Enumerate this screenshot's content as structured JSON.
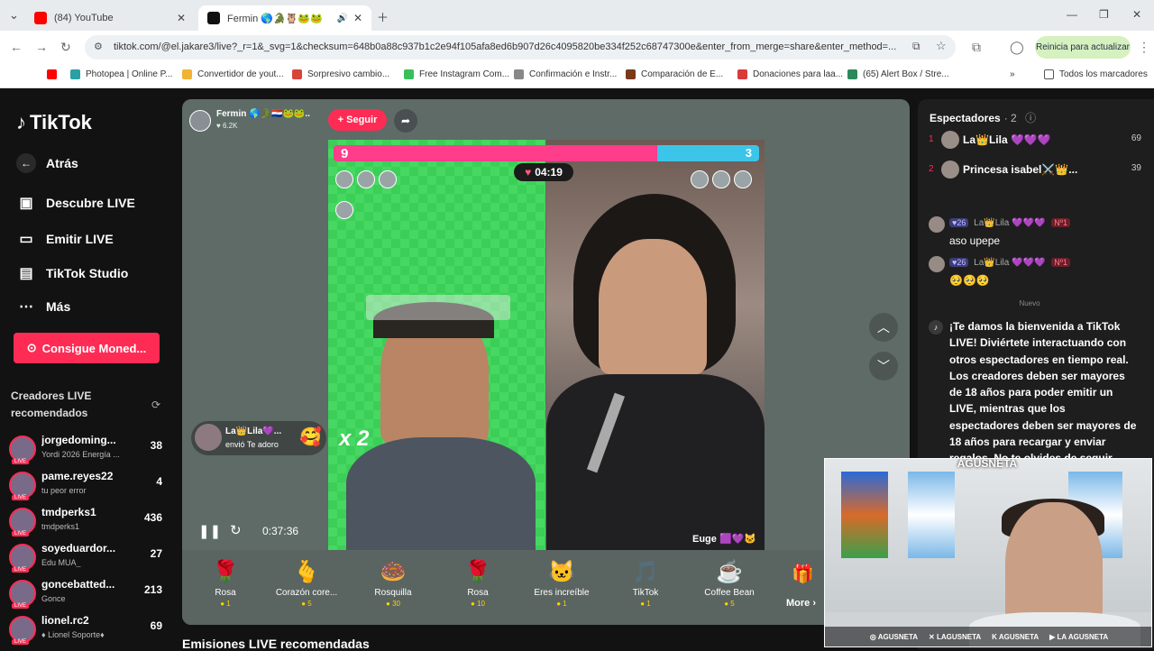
{
  "browser": {
    "tabs": [
      {
        "title": "(84) YouTube",
        "active": false,
        "favicon_color": "#ff0000"
      },
      {
        "title": "Fermin 🌎🐊🦉🐸🐸",
        "active": true,
        "favicon_color": "#111111"
      }
    ],
    "url": "tiktok.com/@el.jakare3/live?_r=1&_svg=1&checksum=648b0a88c937b1c2e94f105afa8ed6b907d26c4095820be334f252c68747300e&enter_from_merge=share&enter_method=...",
    "update_button": "Reinicia para actualizar",
    "bookmarks": [
      "Photopea | Online P...",
      "Convertidor de yout...",
      "Sorpresivo cambio...",
      "Free Instagram Com...",
      "Confirmación e Instr...",
      "Comparación de E...",
      "Donaciones para laa...",
      "(65) Alert Box / Stre..."
    ],
    "all_bookmarks": "Todos los marcadores"
  },
  "sidebar": {
    "logo": "TikTok",
    "back": "Atrás",
    "nav": [
      {
        "label": "Descubre LIVE",
        "icon": "calendar-icon"
      },
      {
        "label": "Emitir LIVE",
        "icon": "camera-icon"
      },
      {
        "label": "TikTok Studio",
        "icon": "studio-icon"
      },
      {
        "label": "Más",
        "icon": "more-icon"
      }
    ],
    "coins_button": "Consigue Moned...",
    "recommended_title": "Creadores LIVE recomendados",
    "live_badge": "LIVE",
    "creators": [
      {
        "name": "jorgedoming...",
        "sub": "Yordi 2026 Energía ...",
        "count": "38"
      },
      {
        "name": "pame.reyes22",
        "sub": "tu peor error",
        "count": "4"
      },
      {
        "name": "tmdperks1",
        "sub": "tmdperks1",
        "count": "436"
      },
      {
        "name": "soyeduardor...",
        "sub": "Edu MUA_",
        "count": "27"
      },
      {
        "name": "goncebatted...",
        "sub": "Gonce",
        "count": "213"
      },
      {
        "name": "lionel.rc2",
        "sub": "♦ Lionel Soporte♦",
        "count": "69"
      }
    ]
  },
  "stage": {
    "host_name": "Fermin 🌎🐊🇵🇾🐸🐸..",
    "host_likes": "♥ 6.2K",
    "follow": "+ Seguir",
    "score_left": "9",
    "score_right": "3",
    "timer": "04:19",
    "multiplier": "x 2",
    "opponent_name": "Euge 🟪💜🐱",
    "gift_notice_name": "La👑Lila💜...",
    "gift_notice_text": "envió Te adoro",
    "elapsed": "0:37:36",
    "gifts": [
      {
        "label": "Rosa",
        "price": "1",
        "icon": "🌹"
      },
      {
        "label": "Corazón core...",
        "price": "5",
        "icon": "🫰"
      },
      {
        "label": "Rosquilla",
        "price": "30",
        "icon": "🍩"
      },
      {
        "label": "Rosa",
        "price": "10",
        "icon": "🌹"
      },
      {
        "label": "Eres increíble",
        "price": "1",
        "icon": "🐱"
      },
      {
        "label": "TikTok",
        "price": "1",
        "icon": "🎵"
      },
      {
        "label": "Coffee Bean",
        "price": "5",
        "icon": "☕"
      }
    ],
    "more": "More ›",
    "recommended_section": "Emisiones LIVE recomendadas"
  },
  "chat": {
    "title": "Espectadores",
    "count": "· 2",
    "viewers": [
      {
        "rank": "1",
        "name": "La👑Lila 💜💜💜",
        "score": "69"
      },
      {
        "rank": "2",
        "name": "Princesa isabel⚔️👑...",
        "score": "39"
      }
    ],
    "messages": [
      {
        "level": "26",
        "name": "La👑Lila 💜💜💜",
        "badge": "Nº1",
        "text": "aso upepe"
      },
      {
        "level": "26",
        "name": "La👑Lila 💜💜💜",
        "badge": "Nº1",
        "text": "🥺🥺🥺"
      }
    ],
    "nuevo": "Nuevo",
    "welcome": "¡Te damos la bienvenida a TikTok LIVE! Diviértete interactuando con otros espectadores en tiempo real. Los creadores deben ser mayores de 18 años para poder emitir un LIVE, mientras que los espectadores deben ser mayores de 18 años para recargar y enviar regalos. No te olvides de seguir"
  },
  "webcam": {
    "logo": "AGUSNETA",
    "socials": [
      "AGUSNETA",
      "LAGUSNETA",
      "AGUSNETA",
      "LA AGUSNETA"
    ]
  },
  "colors": {
    "accent": "#fe2c55",
    "bg": "#121212",
    "stage": "#5e6b66"
  }
}
